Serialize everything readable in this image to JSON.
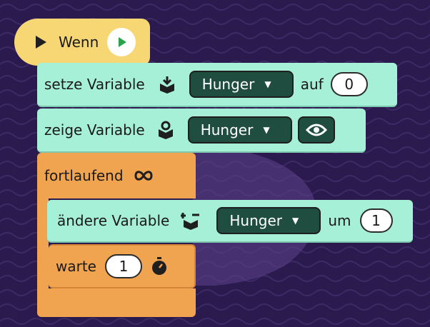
{
  "hat_block": {
    "label": "Wenn"
  },
  "set_block": {
    "label": "setze Variable",
    "variable": "Hunger",
    "to_label": "auf",
    "value": "0"
  },
  "show_block": {
    "label": "zeige Variable",
    "variable": "Hunger"
  },
  "forever_block": {
    "label": "fortlaufend"
  },
  "change_block": {
    "label": "ändere Variable",
    "variable": "Hunger",
    "by_label": "um",
    "value": "1"
  },
  "wait_block": {
    "label": "warte",
    "value": "1"
  },
  "colors": {
    "canvas": "#2b1a4e",
    "hat": "#f7d774",
    "variable_block": "#a6f0d8",
    "control_block": "#f0a450",
    "dropdown": "#1f4d3f"
  },
  "icons": {
    "hat": "play-icon",
    "hat_button": "green-flag-play-icon",
    "set": "download-box-icon",
    "show": "location-box-icon",
    "forever": "infinity-arrows-icon",
    "change": "plus-minus-box-icon",
    "wait": "stopwatch-icon",
    "show_toggle": "eye-icon"
  }
}
